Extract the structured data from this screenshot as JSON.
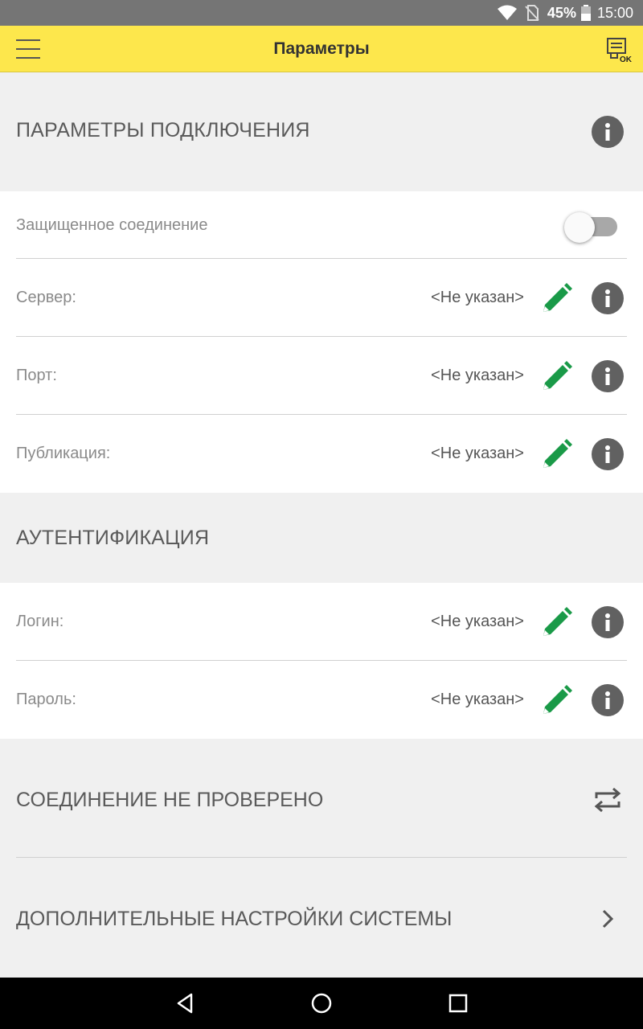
{
  "status_bar": {
    "battery": "45%",
    "time": "15:00",
    "icons": [
      "wifi-icon",
      "no-sim-icon",
      "battery-icon"
    ]
  },
  "app_bar": {
    "title": "Параметры",
    "menu_icon": "hamburger-menu-icon",
    "ok_icon": "document-ok-icon",
    "background": "#fde74c"
  },
  "connection": {
    "header": "ПАРАМЕТРЫ ПОДКЛЮЧЕНИЯ",
    "secure_label": "Защищенное соединение",
    "secure_enabled": false,
    "server_label": "Сервер:",
    "server_value": "<Не указан>",
    "port_label": "Порт:",
    "port_value": "<Не указан>",
    "publication_label": "Публикация:",
    "publication_value": "<Не указан>"
  },
  "auth": {
    "header": "АУТЕНТИФИКАЦИЯ",
    "login_label": "Логин:",
    "login_value": "<Не указан>",
    "password_label": "Пароль:",
    "password_value": "<Не указан>"
  },
  "check": {
    "label": "СОЕДИНЕНИЕ НЕ ПРОВЕРЕНО",
    "icon": "sync-arrows-icon"
  },
  "advanced": {
    "label": "ДОПОЛНИТЕЛЬНЫЕ НАСТРОЙКИ СИСТЕМЫ",
    "icon": "chevron-right-icon"
  },
  "colors": {
    "accent_green": "#1a9a48",
    "info_gray": "#616161"
  },
  "nav_bar": {
    "icons": [
      "back-icon",
      "home-icon",
      "recents-icon"
    ]
  }
}
